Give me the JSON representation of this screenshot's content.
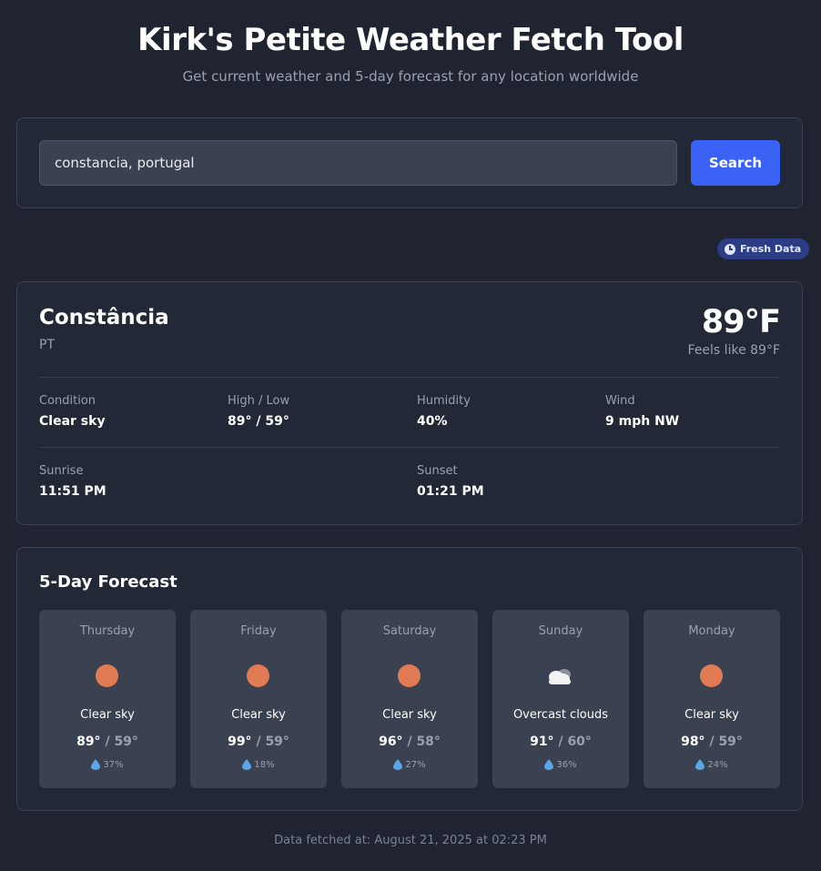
{
  "header": {
    "title": "Kirk's Petite Weather Fetch Tool",
    "subtitle": "Get current weather and 5-day forecast for any location worldwide"
  },
  "search": {
    "value": "constancia, portugal",
    "button_label": "Search"
  },
  "badge": {
    "label": "Fresh Data",
    "icon": "clock-icon"
  },
  "current": {
    "city": "Constância",
    "country": "PT",
    "temperature": "89°F",
    "feels_like": "Feels like 89°F",
    "condition_label": "Condition",
    "condition": "Clear sky",
    "highlow_label": "High / Low",
    "highlow": "89° / 59°",
    "humidity_label": "Humidity",
    "humidity": "40%",
    "wind_label": "Wind",
    "wind": "9 mph NW",
    "sunrise_label": "Sunrise",
    "sunrise": "11:51 PM",
    "sunset_label": "Sunset",
    "sunset": "01:21 PM"
  },
  "forecast": {
    "title": "5-Day Forecast",
    "days": [
      {
        "day": "Thursday",
        "icon": "sun-icon",
        "condition": "Clear sky",
        "high": "89°",
        "low": "59°",
        "precip": "37%"
      },
      {
        "day": "Friday",
        "icon": "sun-icon",
        "condition": "Clear sky",
        "high": "99°",
        "low": "59°",
        "precip": "18%"
      },
      {
        "day": "Saturday",
        "icon": "sun-icon",
        "condition": "Clear sky",
        "high": "96°",
        "low": "58°",
        "precip": "27%"
      },
      {
        "day": "Sunday",
        "icon": "cloud-icon",
        "condition": "Overcast clouds",
        "high": "91°",
        "low": "60°",
        "precip": "36%"
      },
      {
        "day": "Monday",
        "icon": "sun-icon",
        "condition": "Clear sky",
        "high": "98°",
        "low": "59°",
        "precip": "24%"
      }
    ],
    "separator": "/"
  },
  "footer": {
    "text": "Data fetched at: August 21, 2025 at 02:23 PM"
  },
  "colors": {
    "background": "#1f2430",
    "panel": "#222836",
    "card": "#3a4150",
    "accent": "#3a62f5",
    "sun": "#e07b53",
    "badge": "#2c3d85"
  }
}
